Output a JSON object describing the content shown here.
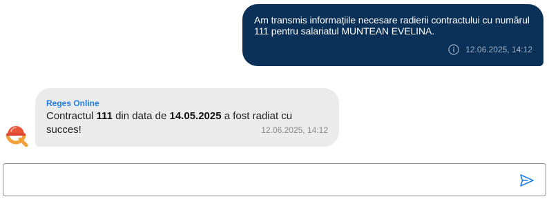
{
  "outgoing": {
    "text": "Am transmis informațiile necesare radierii contractului cu numărul 111 pentru salariatul MUNTEAN EVELINA.",
    "timestamp": "12.06.2025, 14:12",
    "status_icon": "info-icon"
  },
  "incoming": {
    "sender": "Reges Online",
    "text_part1": "Contractul ",
    "contract_number": "111",
    "text_part2": " din data de ",
    "date": "14.05.2025",
    "text_part3": " a fost radiat cu succes!",
    "timestamp": "12.06.2025, 14:12",
    "avatar_icon": "reges-logo-icon"
  },
  "composer": {
    "value": "",
    "placeholder": "",
    "send_icon": "send-icon"
  },
  "colors": {
    "outgoing_bg": "#0b3158",
    "incoming_bg": "#ebebeb",
    "sender": "#1f7fe6",
    "send_icon": "#1f7fe6"
  }
}
